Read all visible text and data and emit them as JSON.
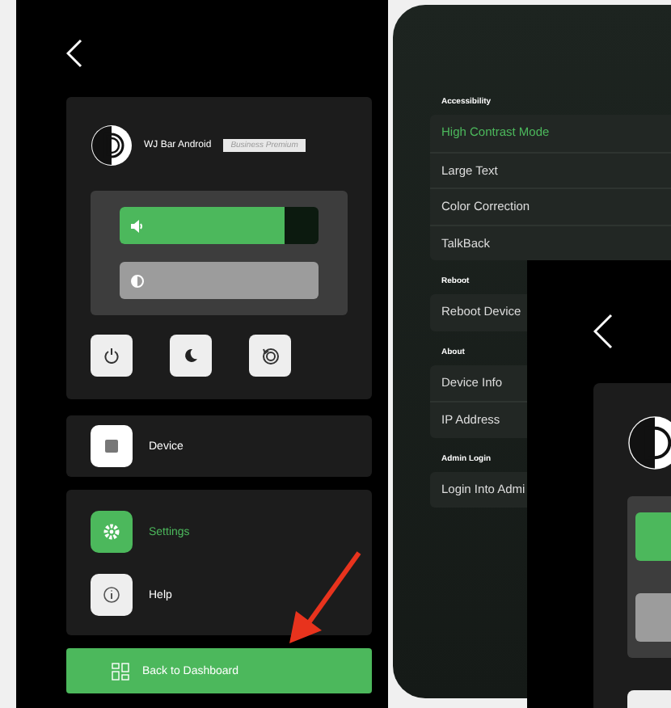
{
  "control_panel": {
    "device_name": "WJ Bar Android",
    "plan_badge": "Business Premium",
    "sliders": [
      {
        "kind": "volume",
        "level": 0.83
      },
      {
        "kind": "brightness",
        "level": 1
      }
    ],
    "quick_buttons": [
      {
        "kind": "power"
      },
      {
        "kind": "moon"
      },
      {
        "kind": "restore"
      }
    ],
    "device_item": {
      "label": "Device",
      "selected": false
    },
    "menu_items": [
      {
        "kind": "settings",
        "label": "Settings",
        "selected": true
      },
      {
        "kind": "help",
        "label": "Help",
        "selected": false
      }
    ],
    "back_button": "Back to Dashboard"
  },
  "settings": {
    "sections": [
      {
        "title": "Accessibility",
        "items": [
          {
            "label": "High Contrast Mode",
            "selected": true
          },
          {
            "label": "Large Text",
            "selected": false
          },
          {
            "label": "Color Correction",
            "selected": false
          },
          {
            "label": "TalkBack",
            "selected": false
          }
        ]
      },
      {
        "title": "Reboot",
        "items": [
          {
            "label": "Reboot Device",
            "selected": false
          }
        ]
      },
      {
        "title": "About",
        "items": [
          {
            "label": "Device Info",
            "selected": false
          },
          {
            "label": "IP Address",
            "selected": false
          }
        ]
      },
      {
        "title": "Admin Login",
        "items": [
          {
            "label": "Login Into Admi",
            "selected": false
          }
        ]
      }
    ]
  }
}
